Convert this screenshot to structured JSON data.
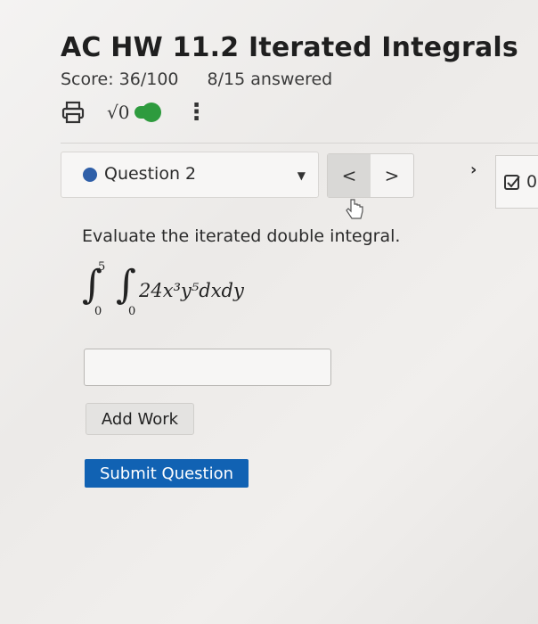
{
  "header": {
    "title": "AC HW 11.2 Iterated Integrals",
    "score": "Score: 36/100",
    "answered": "8/15 answered"
  },
  "toolbar": {
    "sqrt_label": "√0",
    "toggle_on": true,
    "icons": [
      "print-icon",
      "toggle-icon",
      "kebab-menu-icon"
    ]
  },
  "question_nav": {
    "label": "Question 2",
    "caret": "▼",
    "prev": "<",
    "next": ">"
  },
  "right_panel": {
    "count": "0",
    "icon": "checkbox-icon"
  },
  "question": {
    "prompt": "Evaluate the iterated double integral.",
    "integral_sign": "∫",
    "outer_upper": "5",
    "outer_lower": "0",
    "inner_lower": "0",
    "integrand": "24x³y⁵dxdy"
  },
  "answer": {
    "value": ""
  },
  "buttons": {
    "add_work": "Add Work",
    "submit": "Submit Question"
  },
  "colors": {
    "accent": "#1162b3",
    "toggle": "#2e9b3e",
    "dot": "#2f5fa8"
  }
}
